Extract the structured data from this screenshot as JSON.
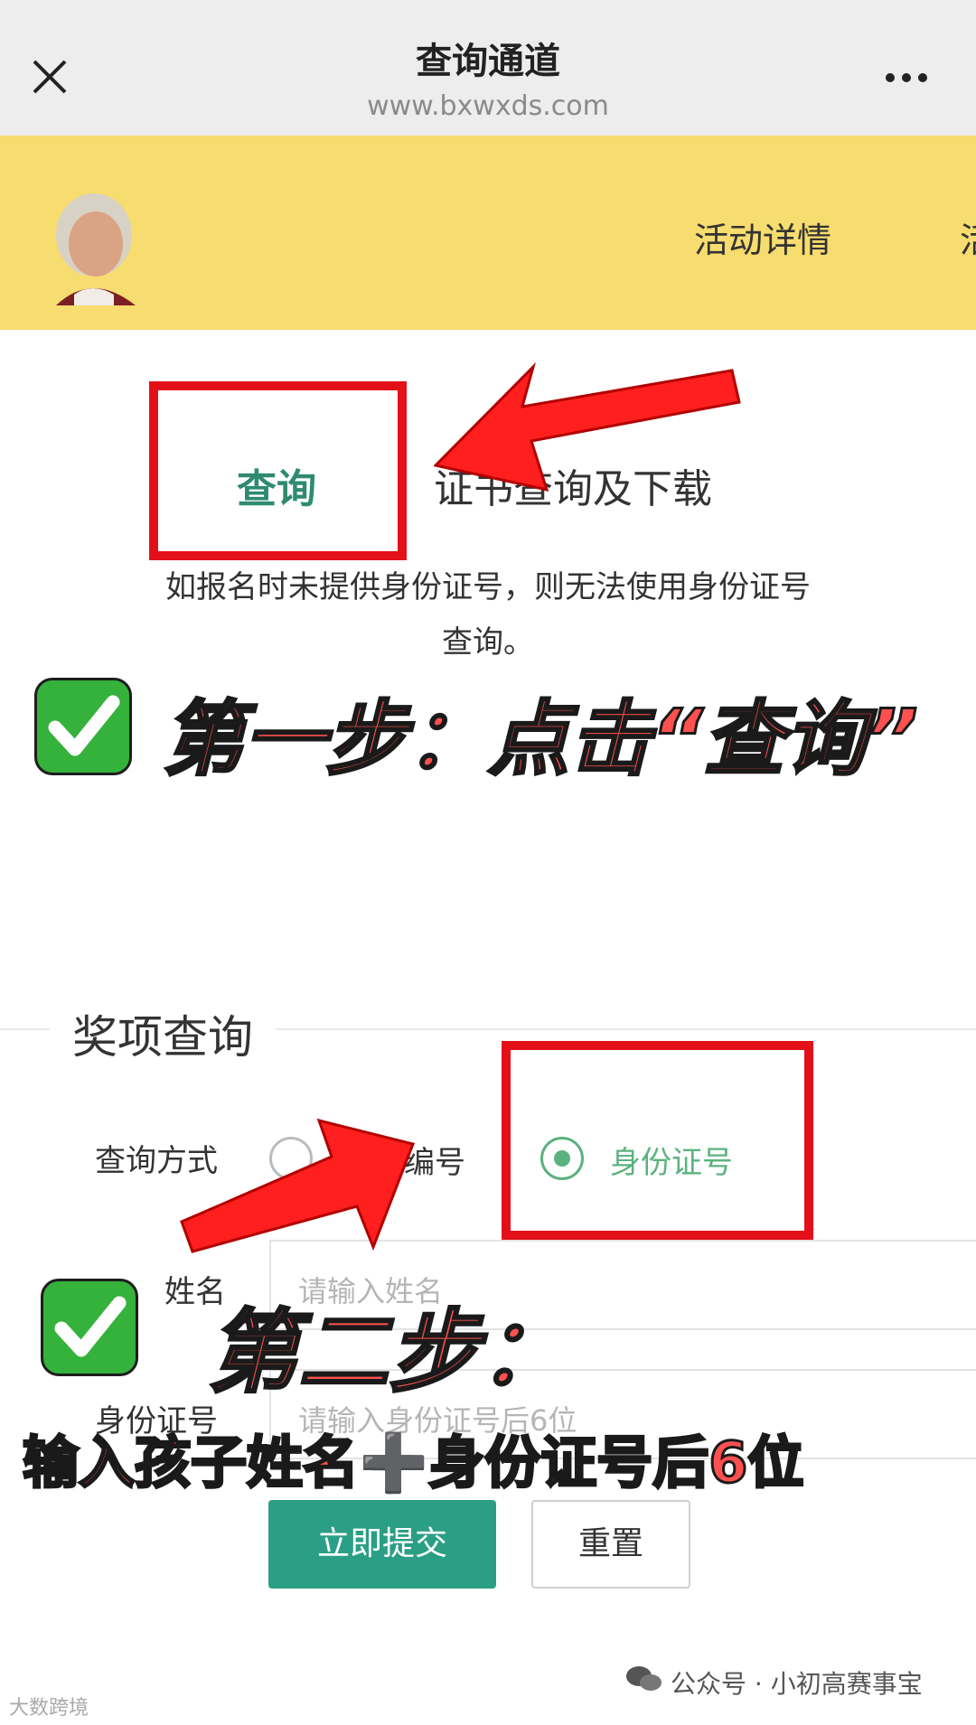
{
  "window": {
    "title": "查询通道",
    "url": "www.bxwxds.com"
  },
  "banner": {
    "nav_items": [
      "活动详情",
      "活"
    ]
  },
  "tabs": {
    "active": "查询",
    "other": "证书查询及下载"
  },
  "notice": {
    "line1": "如报名时未提供身份证号，则无法使用身份证号",
    "line2": "查询。"
  },
  "annotations": {
    "step1": "第一步：点击“查询”",
    "step2": "第二步：",
    "step2_detail": "输入孩子姓名➕身份证号后6位",
    "check_icon": "white-check-mark-emoji",
    "colors": {
      "red": "#e3101a",
      "check_green": "#35b23c"
    }
  },
  "award_form": {
    "section_title": "奖项查询",
    "method_label": "查询方式",
    "options": [
      {
        "label": "编号",
        "selected": false
      },
      {
        "label": "身份证号",
        "selected": true
      }
    ],
    "name_label": "姓名",
    "name_placeholder": "请输入姓名",
    "id_label": "身份证号",
    "id_placeholder": "请输入身份证号后6位",
    "submit_label": "立即提交",
    "reset_label": "重置"
  },
  "footer": {
    "source": "公众号 · 小初高赛事宝",
    "watermark": "大数跨境"
  },
  "colors": {
    "accent": "#2b9f85",
    "radio_selected": "#5bb27e",
    "banner_bg": "#f7dc6f"
  }
}
